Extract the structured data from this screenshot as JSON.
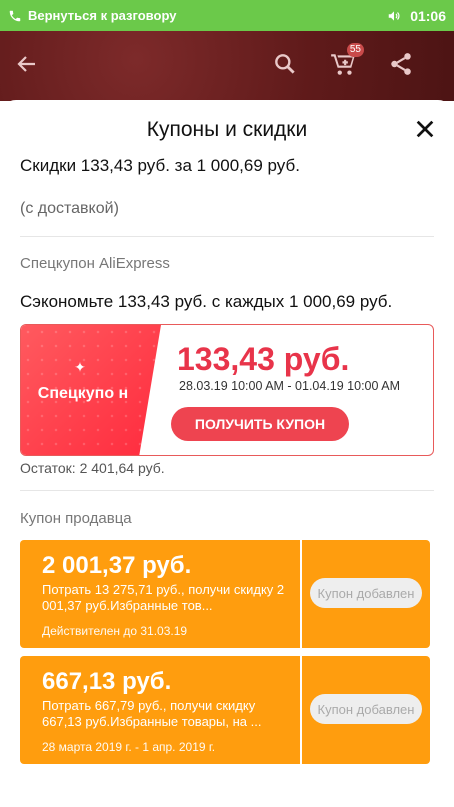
{
  "status_bar": {
    "call_text": "Вернуться к разговору",
    "time": "01:06",
    "color": "#6bc94a"
  },
  "app_bar": {
    "cart_badge": "55",
    "icons": [
      "back-arrow-icon",
      "search-icon",
      "cart-icon",
      "share-icon"
    ]
  },
  "sheet": {
    "title": "Купоны и скидки",
    "summary": "Скидки 133,43 руб. за  1 000,69 руб.",
    "delivery": "(с доставкой)",
    "special_section": {
      "title": "Спецкупон AliExpress",
      "save_text": "Сэкономьте 133,43 руб. с каждых 1 000,69 руб.",
      "coupon": {
        "label": "Спецкупо н",
        "amount": "133,43 руб.",
        "dates": "28.03.19 10:00 AM - 01.04.19 10:00 AM",
        "button": "ПОЛУЧИТЬ КУПОН",
        "accent": "#e8344a"
      },
      "remaining": "Остаток: 2 401,64 руб."
    },
    "seller_section": {
      "title": "Купон продавца",
      "coupons": [
        {
          "amount": "2 001,37 руб.",
          "description": "Потрать 13 275,71 руб., получи скидку 2 001,37 руб.Избранные тов...",
          "validity": "Действителен до 31.03.19",
          "button": "Купон добавлен"
        },
        {
          "amount": "667,13 руб.",
          "description": "Потрать 667,79 руб., получи скидку 667,13 руб.Избранные товары, на ...",
          "validity": "28 марта 2019 г. - 1 апр. 2019 г.",
          "button": "Купон добавлен"
        }
      ],
      "color": "#ff9d0e"
    }
  }
}
